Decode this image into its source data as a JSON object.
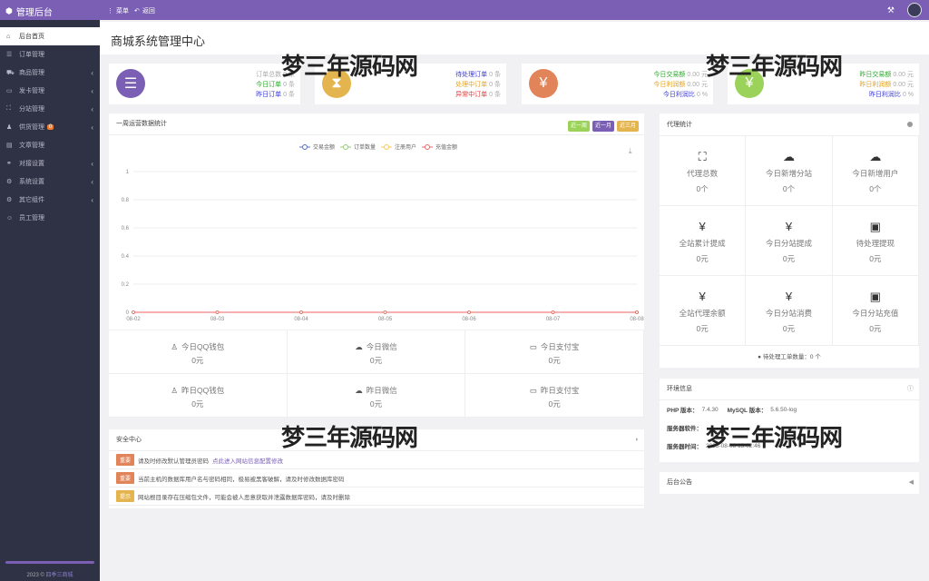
{
  "topbar": {
    "brand": "管理后台",
    "menu_label": "菜单",
    "back_label": "返回"
  },
  "sidebar": {
    "items": [
      {
        "label": "后台首页",
        "icon": "home-icon",
        "glyph": "⌂",
        "active": true,
        "chevron": false
      },
      {
        "label": "订单管理",
        "icon": "list-icon",
        "glyph": "☰",
        "active": false,
        "chevron": false
      },
      {
        "label": "商品管理",
        "icon": "cart-icon",
        "glyph": "⛟",
        "active": false,
        "chevron": true
      },
      {
        "label": "发卡管理",
        "icon": "card-icon",
        "glyph": "▭",
        "active": false,
        "chevron": true
      },
      {
        "label": "分站管理",
        "icon": "sitemap-icon",
        "glyph": "⛶",
        "active": false,
        "chevron": true
      },
      {
        "label": "供货管理",
        "icon": "users-icon",
        "glyph": "♟",
        "active": false,
        "chevron": true,
        "badge": "0"
      },
      {
        "label": "文章管理",
        "icon": "document-icon",
        "glyph": "▤",
        "active": false,
        "chevron": false
      },
      {
        "label": "对接设置",
        "icon": "link-icon",
        "glyph": "⚭",
        "active": false,
        "chevron": true
      },
      {
        "label": "系统设置",
        "icon": "gear-icon",
        "glyph": "⚙",
        "active": false,
        "chevron": true
      },
      {
        "label": "其它组件",
        "icon": "plugin-icon",
        "glyph": "⚙",
        "active": false,
        "chevron": true
      },
      {
        "label": "员工管理",
        "icon": "user-icon",
        "glyph": "☺",
        "active": false,
        "chevron": false
      }
    ],
    "footer_year": "2023 ©",
    "footer_link": "四季三商城"
  },
  "header": {
    "title": "商城系统管理中心"
  },
  "stats": [
    {
      "icon": "list-icon",
      "glyph": "☰",
      "color": "#7a5fb5",
      "lines": [
        {
          "label": "订单总数",
          "value": "0 条",
          "color": "#aaa"
        },
        {
          "label": "今日订单",
          "value": "0 条",
          "color": "#2bab2b"
        },
        {
          "label": "昨日订单",
          "value": "0 条",
          "color": "#3b3bd6"
        }
      ]
    },
    {
      "icon": "hourglass-icon",
      "glyph": "⧗",
      "color": "#e4b54f",
      "lines": [
        {
          "label": "待处理订单",
          "value": "0 条",
          "color": "#3b3bd6"
        },
        {
          "label": "处理中订单",
          "value": "0 条",
          "color": "#e5a322"
        },
        {
          "label": "异常中订单",
          "value": "0 条",
          "color": "#e23b3b"
        }
      ]
    },
    {
      "icon": "yen-icon",
      "glyph": "¥",
      "color": "#e2845a",
      "lines": [
        {
          "label": "今日交易额",
          "value": "0.00 元",
          "color": "#2bab2b"
        },
        {
          "label": "今日利润额",
          "value": "0.00 元",
          "color": "#e5a322"
        },
        {
          "label": "今日利润比",
          "value": "0 %",
          "color": "#3b3bd6"
        }
      ]
    },
    {
      "icon": "yen-icon",
      "glyph": "¥",
      "color": "#9bd35a",
      "lines": [
        {
          "label": "昨日交易额",
          "value": "0.00 元",
          "color": "#2bab2b"
        },
        {
          "label": "昨日利润额",
          "value": "0.00 元",
          "color": "#e5a322"
        },
        {
          "label": "昨日利润比",
          "value": "0 %",
          "color": "#3b3bd6"
        }
      ]
    }
  ],
  "chart_panel": {
    "title": "一周运营数据统计",
    "filters": [
      {
        "label": "近一周",
        "color": "#9bd35a"
      },
      {
        "label": "近一月",
        "color": "#7a5fb5"
      },
      {
        "label": "近三月",
        "color": "#e4b54f"
      }
    ]
  },
  "chart_data": {
    "type": "line",
    "categories": [
      "08-02",
      "08-03",
      "08-04",
      "08-05",
      "08-06",
      "08-07",
      "08-08"
    ],
    "yticks": [
      "0",
      "0.2",
      "0.4",
      "0.6",
      "0.8",
      "1"
    ],
    "ylim": [
      0,
      1
    ],
    "grid": true,
    "legend_position": "top-center",
    "series": [
      {
        "name": "交易金额",
        "color": "#5470c6",
        "values": [
          0,
          0,
          0,
          0,
          0,
          0,
          0
        ]
      },
      {
        "name": "订单数量",
        "color": "#91cc75",
        "values": [
          0,
          0,
          0,
          0,
          0,
          0,
          0
        ]
      },
      {
        "name": "注册用户",
        "color": "#fac858",
        "values": [
          0,
          0,
          0,
          0,
          0,
          0,
          0
        ]
      },
      {
        "name": "充值金额",
        "color": "#ee6666",
        "values": [
          0,
          0,
          0,
          0,
          0,
          0,
          0
        ]
      }
    ]
  },
  "pay_stats": [
    {
      "label": "今日QQ钱包",
      "value": "0元",
      "icon": "qq-icon",
      "glyph": "♙"
    },
    {
      "label": "今日微信",
      "value": "0元",
      "icon": "wechat-icon",
      "glyph": "☁"
    },
    {
      "label": "今日支付宝",
      "value": "0元",
      "icon": "card-icon",
      "glyph": "▭"
    },
    {
      "label": "昨日QQ钱包",
      "value": "0元",
      "icon": "qq-icon",
      "glyph": "♙"
    },
    {
      "label": "昨日微信",
      "value": "0元",
      "icon": "wechat-icon",
      "glyph": "☁"
    },
    {
      "label": "昨日支付宝",
      "value": "0元",
      "icon": "card-icon",
      "glyph": "▭"
    }
  ],
  "security": {
    "title": "安全中心",
    "notices": [
      {
        "tag": "重要",
        "tag_color": "#e2845a",
        "text": "请及时修改默认管理员密码",
        "link": "点此进入网站信息配置修改"
      },
      {
        "tag": "重要",
        "tag_color": "#e2845a",
        "text": "当前主机的数据库用户名与密码相同，极易被黑客破解，请及时修改数据库密码",
        "link": ""
      },
      {
        "tag": "提示",
        "tag_color": "#e4b54f",
        "text": "网站根目录存在压缩包文件，可能会被人恶意获取并泄露数据库密码，请及时删除",
        "link": ""
      }
    ]
  },
  "agent_panel": {
    "title": "代理统计",
    "cells": [
      {
        "label": "代理总数",
        "value": "0个",
        "icon": "sitemap-icon",
        "glyph": "⛶"
      },
      {
        "label": "今日新增分站",
        "value": "0个",
        "icon": "cloud-icon",
        "glyph": "☁"
      },
      {
        "label": "今日新增用户",
        "value": "0个",
        "icon": "cloud-icon",
        "glyph": "☁"
      },
      {
        "label": "全站累计提成",
        "value": "0元",
        "icon": "yen-icon",
        "glyph": "¥"
      },
      {
        "label": "今日分站提成",
        "value": "0元",
        "icon": "yen-icon",
        "glyph": "¥"
      },
      {
        "label": "待处理提现",
        "value": "0元",
        "icon": "money-icon",
        "glyph": "▣"
      },
      {
        "label": "全站代理余额",
        "value": "0元",
        "icon": "yen-icon",
        "glyph": "¥"
      },
      {
        "label": "今日分站消费",
        "value": "0元",
        "icon": "yen-icon",
        "glyph": "¥"
      },
      {
        "label": "今日分站充值",
        "value": "0元",
        "icon": "money-icon",
        "glyph": "▣"
      }
    ],
    "footer": "待处理工单数量：0 个"
  },
  "env_panel": {
    "title": "环境信息",
    "php_label": "PHP 版本：",
    "php_value": "7.4.30",
    "mysql_label": "MySQL 版本：",
    "mysql_value": "5.6.50-log",
    "server_label": "服务器软件：",
    "time_label": "服务器时间：",
    "time_value": "2023-08-08 15:02:46"
  },
  "notice_panel": {
    "title": "后台公告"
  },
  "watermark": "梦三年源码网"
}
